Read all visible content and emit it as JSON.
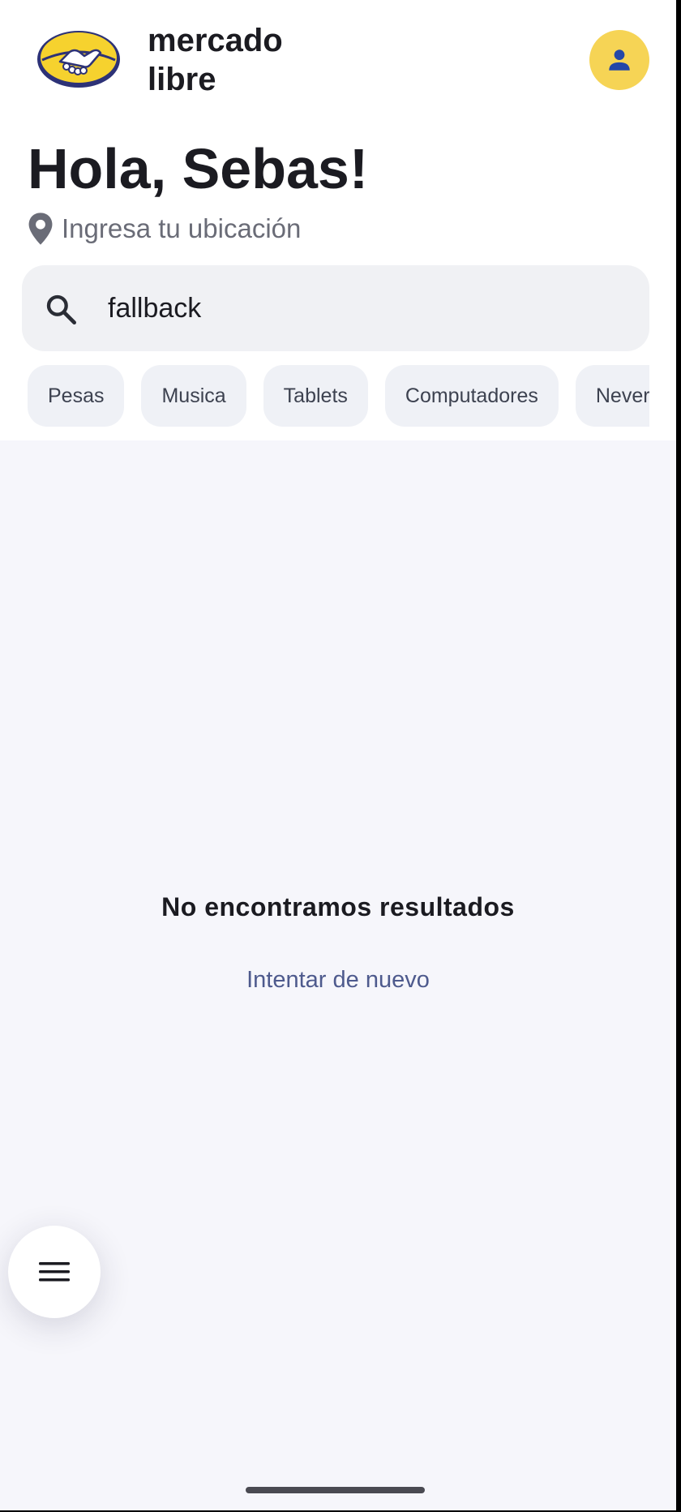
{
  "header": {
    "brand_line1": "mercado",
    "brand_line2": "libre",
    "logo_icon": "handshake-logo-icon",
    "avatar_icon": "person-icon"
  },
  "greeting": "Hola, Sebas!",
  "location": {
    "icon": "location-pin-icon",
    "placeholder": "Ingresa tu ubicación"
  },
  "search": {
    "icon": "search-icon",
    "value": "fallback"
  },
  "categories": [
    "Pesas",
    "Musica",
    "Tablets",
    "Computadores",
    "Neveras"
  ],
  "empty_state": {
    "title": "No encontramos resultados",
    "retry_label": "Intentar de nuevo"
  },
  "fab": {
    "icon": "menu-icon"
  },
  "colors": {
    "accent_yellow": "#f6d455",
    "avatar_icon_blue": "#2447a8",
    "link": "#4e5a8d",
    "background": "#f6f6fb"
  }
}
